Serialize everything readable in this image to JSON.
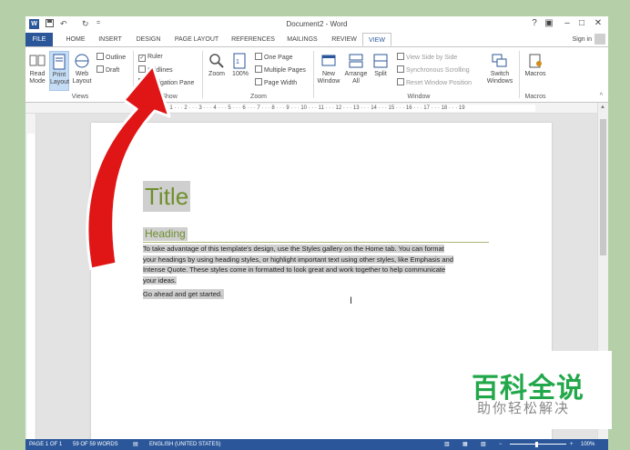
{
  "window": {
    "title": "Document2 - Word",
    "qat_undo": "↶",
    "qat_redo": "↻",
    "controls": [
      "?",
      "▣",
      "–",
      "□",
      "✕"
    ]
  },
  "tabs": [
    "FILE",
    "HOME",
    "INSERT",
    "DESIGN",
    "PAGE LAYOUT",
    "REFERENCES",
    "MAILINGS",
    "REVIEW",
    "VIEW"
  ],
  "active_tab": "VIEW",
  "sign_in": "Sign in",
  "ribbon": {
    "views": {
      "label": "Views",
      "read_mode": "Read Mode",
      "print_layout": "Print Layout",
      "web_layout": "Web Layout",
      "outline": "Outline",
      "draft": "Draft"
    },
    "show": {
      "label": "Show",
      "ruler": "Ruler",
      "gridlines": "Gridlines",
      "navigation_pane": "Navigation Pane"
    },
    "zoom": {
      "label": "Zoom",
      "zoom": "Zoom",
      "hundred": "100%",
      "one_page": "One Page",
      "multiple_pages": "Multiple Pages",
      "page_width": "Page Width"
    },
    "window": {
      "label": "Window",
      "new_window": "New Window",
      "arrange_all": "Arrange All",
      "split": "Split",
      "view_side_by_side": "View Side by Side",
      "synchronous_scrolling": "Synchronous Scrolling",
      "reset_window_position": "Reset Window Position",
      "switch_windows": "Switch Windows"
    },
    "macros": {
      "label": "Macros",
      "macros": "Macros"
    }
  },
  "ruler_ticks": "· 2 · 1 · · · 1 · · · 2 · · · 3 · · · 4 · · · 5 · · · 6 · · · 7 · · · 8 · · · 9 · · · 10 · · · 11 · · · 12 · · · 13 · · · 14 · · · 15 · · · 16 · · · 17 · · · 18 · · · 19",
  "document": {
    "title": "Title",
    "heading": "Heading",
    "paragraph_lines": [
      "To take advantage of this template's design, use the Styles gallery on the Home tab. You can format",
      "your headings by using heading styles, or highlight important text using other styles, like Emphasis and",
      "Intense Quote. These styles come in formatted to look great and work together to help communicate",
      "your ideas."
    ],
    "paragraph2": "Go ahead and get started."
  },
  "status": {
    "page": "PAGE 1 OF 1",
    "words": "59 OF 59 WORDS",
    "language": "ENGLISH (UNITED STATES)",
    "zoom": "100%"
  },
  "watermark": {
    "big": "百科全说",
    "small": "助你轻松解决"
  },
  "colors": {
    "word_blue": "#2b579a",
    "title_green": "#6f8f2f",
    "arrow_red": "#e01515",
    "watermark_green": "#22a84a",
    "background": "#b5cfa8"
  }
}
